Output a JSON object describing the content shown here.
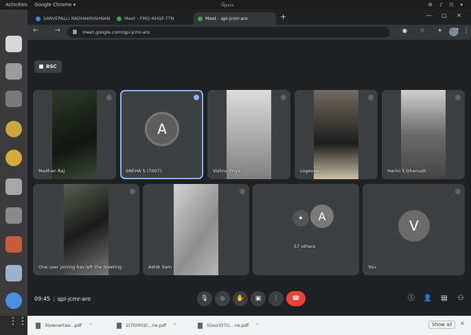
{
  "system_bar": {
    "activities": "Activities",
    "app": "Google Chrome ▾",
    "clock": "நேரம்",
    "indicators": "⚙ ♪ ⏻ ▾"
  },
  "browser": {
    "tabs": [
      {
        "title": "SARVEPALLI RADHAKRISHNAN",
        "active": false
      },
      {
        "title": "Meet - FMQ-NHQF-TTN",
        "active": false
      },
      {
        "title": "Meet - qpi-jcmr-aro",
        "active": true
      }
    ],
    "window_controls": "— ▢ ✕",
    "url": "meet.google.com/qpi-jcmr-aro"
  },
  "meet": {
    "room_label": "BSC",
    "participants": [
      {
        "name": "Madhan Raj",
        "type": "video"
      },
      {
        "name": "SNEHA S (7007)",
        "type": "avatar",
        "speaking": true,
        "initial": "A"
      },
      {
        "name": "Vishnu Priya",
        "type": "video"
      },
      {
        "name": "Logeswari",
        "type": "video"
      },
      {
        "name": "Harini S Dhanush",
        "type": "video"
      },
      {
        "name": "One user joining has left the meeting",
        "type": "video"
      },
      {
        "name": "Ashik Sam",
        "type": "video"
      },
      {
        "name": "57 others",
        "type": "others",
        "initial": "A"
      },
      {
        "name": "You",
        "type": "avatar",
        "initial": "V"
      }
    ],
    "time": "09:45",
    "meeting_code": "qpi-jcmr-aro"
  },
  "downloads": {
    "items": [
      "3(ownertaa...pdf",
      "2(7000)2(...ne.pdf",
      "5(ourt07(c...ne.pdf"
    ],
    "show_all": "Show all"
  },
  "colors": {
    "meet_bg": "#202124",
    "tile_bg": "#3c4043",
    "end_call": "#ea4335",
    "speaking": "#8ab4f8"
  }
}
